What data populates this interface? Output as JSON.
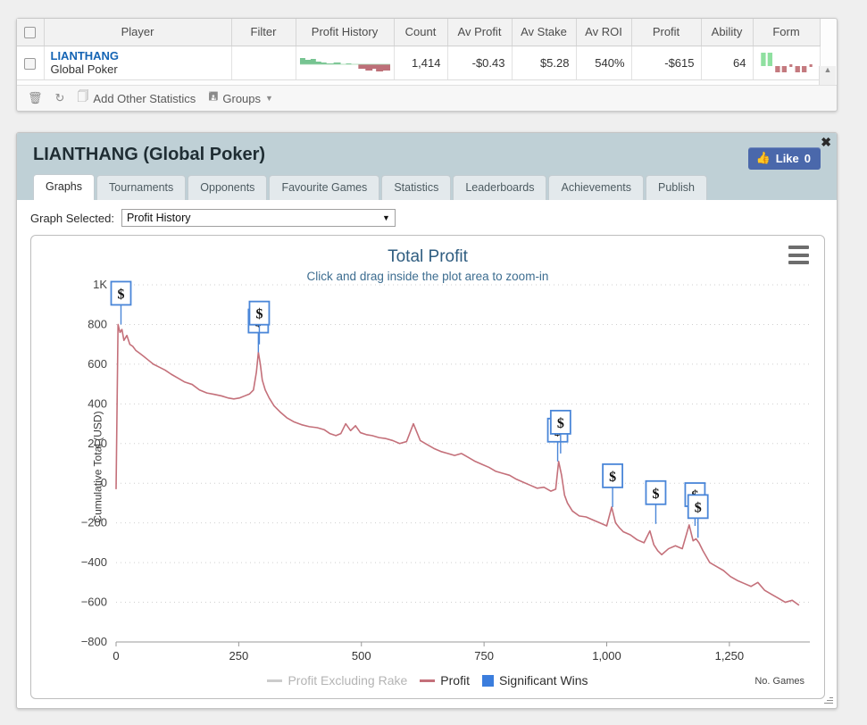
{
  "results_table": {
    "columns": [
      "",
      "Player",
      "Filter",
      "Profit History",
      "Count",
      "Av Profit",
      "Av Stake",
      "Av ROI",
      "Profit",
      "Ability",
      "Form"
    ],
    "rows": [
      {
        "player_name": "LIANTHANG",
        "player_site": "Global Poker",
        "filter": "",
        "count": "1,414",
        "av_profit": "-$0.43",
        "av_stake": "$5.28",
        "av_roi": "540%",
        "profit": "-$615",
        "ability": "64"
      }
    ],
    "toolbar": {
      "delete_label": "",
      "refresh_label": "",
      "add_other_statistics": "Add Other Statistics",
      "groups": "Groups"
    },
    "scroll_up": "▲",
    "scroll_down": "▼"
  },
  "player_panel": {
    "title": "LIANTHANG (Global Poker)",
    "like_label": "Like",
    "like_count": "0",
    "close_label": "✖",
    "tabs": [
      {
        "label": "Graphs",
        "active": true
      },
      {
        "label": "Tournaments",
        "active": false
      },
      {
        "label": "Opponents",
        "active": false
      },
      {
        "label": "Favourite Games",
        "active": false
      },
      {
        "label": "Statistics",
        "active": false
      },
      {
        "label": "Leaderboards",
        "active": false
      },
      {
        "label": "Achievements",
        "active": false
      },
      {
        "label": "Publish",
        "active": false
      }
    ],
    "graph_selected_label": "Graph Selected:",
    "graph_selected_value": "Profit History",
    "graph_options": [
      "Profit History"
    ],
    "menu_icon": "hamburger-icon"
  },
  "colors": {
    "profit_line": "#c4707a",
    "excluding_rake_line": "#cccccc",
    "significant_wins": "#3b7ddd",
    "title": "#2f5d80",
    "panel_header": "#bfd0d6",
    "like_blue": "#4a68ab"
  },
  "chart_data": {
    "type": "line",
    "title": "Total Profit",
    "subtitle": "Click and drag inside the plot area to zoom-in",
    "xlabel": "No. Games",
    "ylabel": "Cumulative Total (USD)",
    "xlim": [
      0,
      1414
    ],
    "ylim": [
      -800,
      1000
    ],
    "xticks": [
      0,
      250,
      500,
      750,
      1000,
      1250
    ],
    "xticklabels": [
      "0",
      "250",
      "500",
      "750",
      "1,000",
      "1,250"
    ],
    "yticks": [
      -800,
      -600,
      -400,
      -200,
      0,
      200,
      400,
      600,
      800,
      1000
    ],
    "yticklabels": [
      "−800",
      "−600",
      "−400",
      "−200",
      "0",
      "200",
      "400",
      "600",
      "800",
      "1K"
    ],
    "grid": true,
    "legend_position": "bottom-center",
    "legend": [
      {
        "name": "Profit Excluding Rake",
        "type": "line",
        "color": "#cccccc"
      },
      {
        "name": "Profit",
        "type": "line",
        "color": "#c4707a"
      },
      {
        "name": "Significant Wins",
        "type": "marker",
        "color": "#3b7ddd"
      }
    ],
    "series": [
      {
        "name": "Profit",
        "color": "#c4707a",
        "x": [
          0,
          4,
          8,
          12,
          16,
          22,
          28,
          34,
          40,
          48,
          56,
          66,
          76,
          88,
          100,
          112,
          126,
          140,
          155,
          170,
          185,
          200,
          215,
          228,
          240,
          252,
          262,
          272,
          280,
          286,
          290,
          294,
          298,
          304,
          312,
          322,
          334,
          348,
          362,
          378,
          394,
          410,
          424,
          436,
          448,
          458,
          468,
          478,
          488,
          498,
          510,
          522,
          536,
          550,
          564,
          578,
          592,
          606,
          620,
          634,
          648,
          662,
          676,
          690,
          704,
          718,
          732,
          746,
          760,
          774,
          788,
          802,
          816,
          830,
          844,
          858,
          872,
          886,
          896,
          902,
          908,
          914,
          920,
          930,
          944,
          958,
          972,
          986,
          1000,
          1010,
          1018,
          1026,
          1034,
          1048,
          1062,
          1076,
          1088,
          1096,
          1104,
          1112,
          1126,
          1140,
          1154,
          1168,
          1176,
          1182,
          1188,
          1196,
          1210,
          1224,
          1238,
          1252,
          1266,
          1280,
          1294,
          1308,
          1322,
          1336,
          1350,
          1364,
          1378,
          1392,
          1405,
          1414
        ],
        "y": [
          -30,
          800,
          760,
          775,
          720,
          745,
          700,
          690,
          670,
          655,
          640,
          620,
          600,
          585,
          570,
          550,
          530,
          510,
          498,
          470,
          455,
          448,
          440,
          430,
          425,
          430,
          440,
          450,
          470,
          560,
          660,
          600,
          520,
          470,
          430,
          390,
          360,
          330,
          310,
          295,
          285,
          280,
          270,
          250,
          240,
          250,
          300,
          265,
          290,
          255,
          245,
          240,
          230,
          225,
          215,
          200,
          210,
          300,
          215,
          195,
          175,
          160,
          150,
          140,
          150,
          130,
          110,
          95,
          80,
          60,
          50,
          40,
          20,
          5,
          -10,
          -25,
          -20,
          -40,
          -30,
          110,
          40,
          -60,
          -100,
          -140,
          -165,
          -170,
          -185,
          -200,
          -215,
          -120,
          -200,
          -225,
          -245,
          -260,
          -285,
          -300,
          -240,
          -310,
          -340,
          -360,
          -330,
          -315,
          -330,
          -210,
          -290,
          -280,
          -300,
          -340,
          -400,
          -420,
          -440,
          -470,
          -490,
          -505,
          -520,
          -500,
          -540,
          -560,
          -580,
          -600,
          -590,
          -615
        ],
        "notes": "Cumulative profit declining from an early peak near $800 down to about -$615 after 1,414 games"
      }
    ],
    "markers": [
      {
        "label": "$",
        "x": 10,
        "y": 800,
        "note": "significant win marker"
      },
      {
        "label": "$",
        "x": 290,
        "y": 660,
        "note": "significant win marker (stacked)"
      },
      {
        "label": "$",
        "x": 292,
        "y": 700,
        "note": "significant win marker (stacked upper)"
      },
      {
        "label": "$",
        "x": 900,
        "y": 110,
        "note": "significant win marker (stacked)"
      },
      {
        "label": "$",
        "x": 906,
        "y": 150,
        "note": "significant win marker (stacked upper)"
      },
      {
        "label": "$",
        "x": 1012,
        "y": -120,
        "note": "significant win marker"
      },
      {
        "label": "$",
        "x": 1100,
        "y": -205,
        "note": "significant win marker"
      },
      {
        "label": "$",
        "x": 1180,
        "y": -215,
        "note": "significant win marker"
      },
      {
        "label": "$",
        "x": 1186,
        "y": -275,
        "note": "significant win marker (stacked lower)"
      }
    ]
  }
}
